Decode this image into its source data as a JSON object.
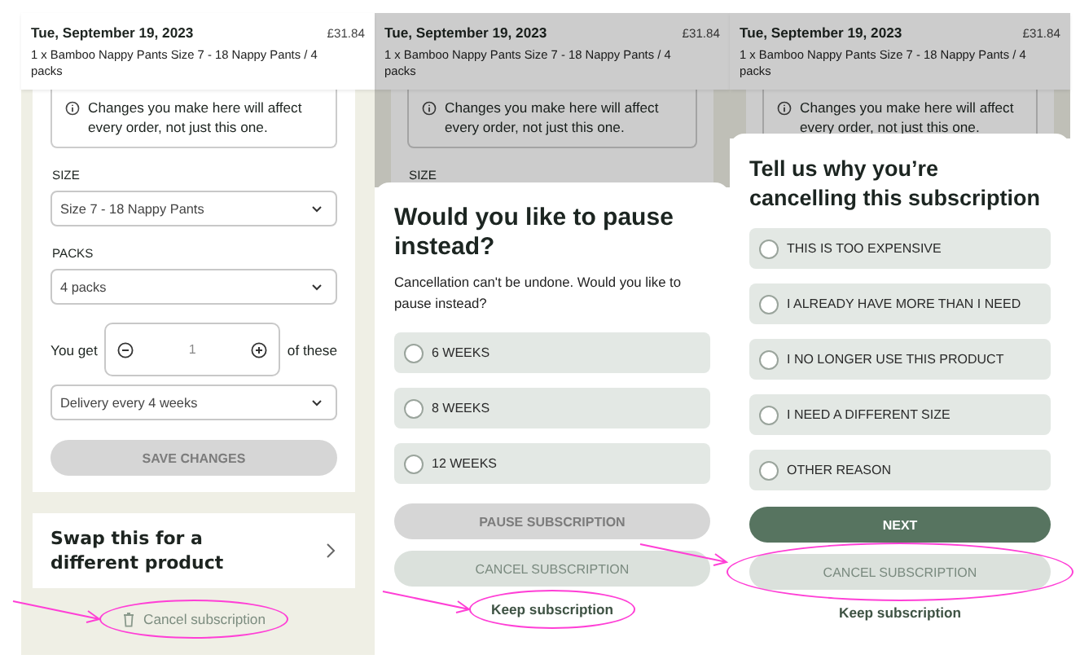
{
  "screens": [
    {
      "kind": "edit",
      "header": {
        "date": "Tue, September 19, 2023",
        "price": "£31.84",
        "description": "1 x Bamboo Nappy Pants Size 7 - 18 Nappy Pants / 4 packs"
      },
      "notice": "Changes you make here will affect every order, not just this one.",
      "form": {
        "fields": [
          {
            "label": "SIZE",
            "value": "Size 7 - 18 Nappy Pants"
          },
          {
            "label": "PACKS",
            "value": "4 packs"
          }
        ],
        "quantity": {
          "prefix": "You get",
          "value": "1",
          "suffix": "of these"
        },
        "delivery": "Delivery every 4 weeks",
        "save_button": {
          "label": "SAVE CHANGES",
          "disabled": true
        }
      },
      "swap_card": {
        "title": "Swap this for a different product"
      },
      "cancel_link": {
        "label": "Cancel subscription",
        "circled": true
      }
    },
    {
      "kind": "dialog",
      "header": {
        "date": "Tue, September 19, 2023",
        "price": "£31.84",
        "description": "1 x Bamboo Nappy Pants Size 7 - 18 Nappy Pants / 4 packs"
      },
      "notice": "Changes you make here will affect every order, not just this one.",
      "background_label": "SIZE",
      "dialog": {
        "title": "Would you like to pause instead?",
        "text": "Cancellation can't be undone. Would you like to pause instead?",
        "options": [
          {
            "label": "6 WEEKS",
            "selected": false
          },
          {
            "label": "8 WEEKS",
            "selected": false
          },
          {
            "label": "12 WEEKS",
            "selected": false
          }
        ],
        "buttons": [
          {
            "label": "PAUSE SUBSCRIPTION",
            "kind": "filled",
            "disabled": true,
            "circled": false
          },
          {
            "label": "CANCEL SUBSCRIPTION",
            "kind": "soft",
            "disabled": false,
            "circled": false
          }
        ],
        "link": {
          "label": "Keep subscription",
          "circled": true
        }
      }
    },
    {
      "kind": "dialog",
      "header": {
        "date": "Tue, September 19, 2023",
        "price": "£31.84",
        "description": "1 x Bamboo Nappy Pants Size 7 - 18 Nappy Pants / 4 packs"
      },
      "notice": "Changes you make here will affect every order, not just this one.",
      "dialog": {
        "title": "Tell us why you’re cancelling this subscription",
        "options": [
          {
            "label": "THIS IS TOO EXPENSIVE",
            "selected": false
          },
          {
            "label": "I ALREADY HAVE MORE THAN I NEED",
            "selected": false
          },
          {
            "label": "I NO LONGER USE THIS PRODUCT",
            "selected": false
          },
          {
            "label": "I NEED A DIFFERENT SIZE",
            "selected": false
          },
          {
            "label": "OTHER REASON",
            "selected": false
          }
        ],
        "buttons": [
          {
            "label": "NEXT",
            "kind": "filled",
            "disabled": false,
            "circled": false
          },
          {
            "label": "CANCEL SUBSCRIPTION",
            "kind": "soft",
            "disabled": false,
            "circled": true
          }
        ],
        "link": {
          "label": "Keep subscription",
          "circled": false
        }
      }
    }
  ]
}
